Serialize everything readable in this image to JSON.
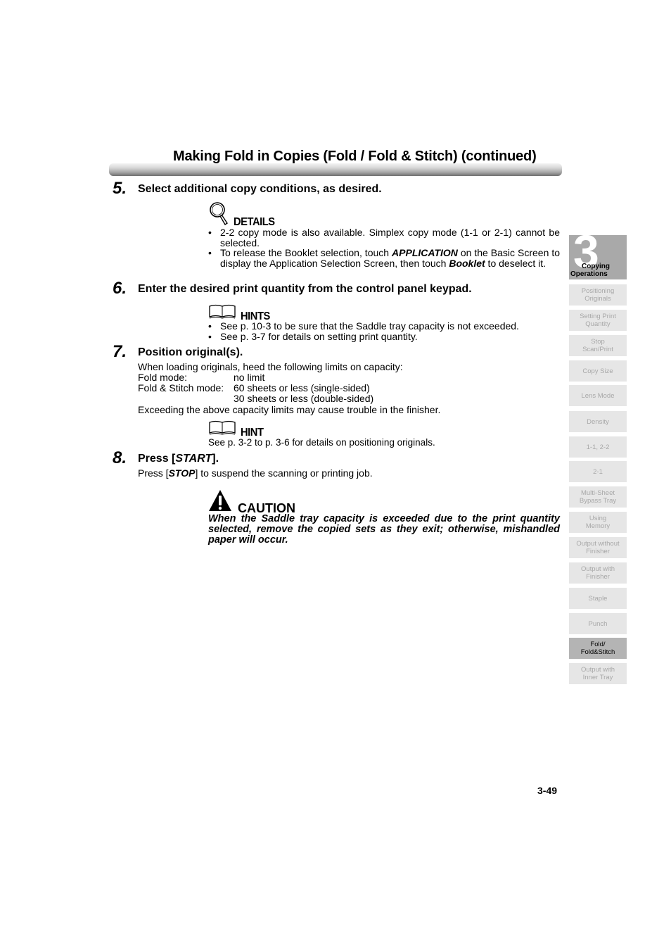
{
  "header": {
    "title": "Making Fold in Copies (Fold / Fold & Stitch) (continued)"
  },
  "steps": [
    {
      "number": "5.",
      "title": "Select additional copy conditions, as desired.",
      "note": {
        "icon": "magnifier-icon",
        "label": "DETAILS",
        "bullets": [
          {
            "text": "2-2 copy mode is also available. Simplex copy mode (1-1 or 2-1) cannot be selected."
          },
          {
            "pre": "To release the Booklet selection, touch ",
            "em1": "APPLICATION",
            "mid": " on the Basic Screen to display the Application Selection Screen, then touch ",
            "em2": "Booklet",
            "post": " to deselect it."
          }
        ]
      }
    },
    {
      "number": "6.",
      "title": "Enter the desired print quantity from the control panel keypad.",
      "note": {
        "icon": "open-book-icon",
        "label": "HINTS",
        "bullets": [
          "See p. 10-3 to be sure that the Saddle tray capacity is not exceeded.",
          "See p. 3-7 for details on setting print quantity."
        ]
      }
    },
    {
      "number": "7.",
      "title": "Position original(s).",
      "intro": "When loading originals, heed the following limits on capacity:",
      "capacity": [
        {
          "label": "Fold mode:",
          "value": "no limit"
        },
        {
          "label": "Fold & Stitch mode:",
          "value": "60 sheets or less (single-sided)"
        },
        {
          "label": "",
          "value": "30 sheets or less (double-sided)"
        }
      ],
      "outro": "Exceeding the above capacity limits may cause trouble in the finisher.",
      "note": {
        "icon": "open-book-icon",
        "label": "HINT",
        "text": "See p. 3-2 to p. 3-6 for details on positioning originals."
      }
    },
    {
      "number": "8.",
      "title_pre": "Press [",
      "title_em": "START",
      "title_post": "].",
      "body_pre": "Press [",
      "body_em": "STOP",
      "body_post": "] to suspend the scanning or printing job.",
      "caution": {
        "icon": "warning-triangle-icon",
        "label": "CAUTION",
        "text": "When the Saddle tray capacity is exceeded due to the print quantity selected, remove the copied sets as they exit; otherwise, mishandled paper will occur."
      }
    }
  ],
  "footer": {
    "page_number": "3-49"
  },
  "sidebar": {
    "chapter_number": "3",
    "chapter_label_1": "Copying",
    "chapter_label_2": "Operations",
    "items": [
      {
        "label": "Positioning\nOriginals"
      },
      {
        "label": "Setting Print\nQuantity"
      },
      {
        "label": "Stop\nScan/Print"
      },
      {
        "label": "Copy Size"
      },
      {
        "label": "Lens Mode"
      },
      {
        "label": "Density"
      },
      {
        "label": "1-1, 2-2"
      },
      {
        "label": "2-1"
      },
      {
        "label": "Multi-Sheet\nBypass Tray"
      },
      {
        "label": "Using\nMemory"
      },
      {
        "label": "Output without\nFinisher"
      },
      {
        "label": "Output with\nFinisher"
      },
      {
        "label": "Staple"
      },
      {
        "label": "Punch"
      },
      {
        "label": "Fold/\nFold&Stitch",
        "active": true
      },
      {
        "label": "Output with\nInner Tray"
      }
    ]
  }
}
